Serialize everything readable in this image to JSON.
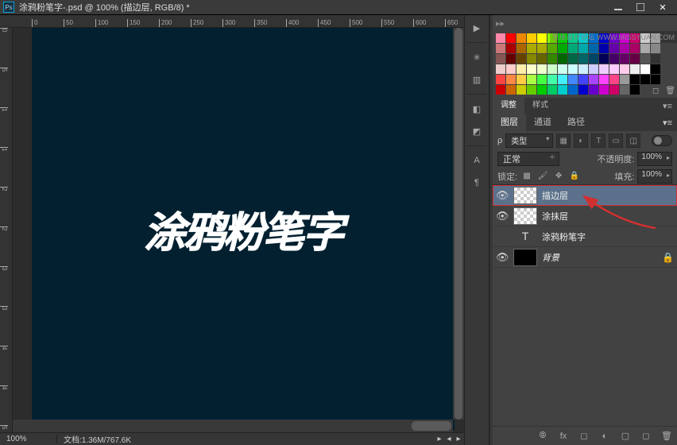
{
  "titlebar": {
    "ps": "Ps",
    "title": "涂鸦粉笔字-.psd @ 100% (描边层, RGB/8) *"
  },
  "ruler_h": [
    "0",
    "50",
    "100",
    "150",
    "200",
    "250",
    "300",
    "350",
    "400",
    "450",
    "500",
    "550",
    "600",
    "650"
  ],
  "ruler_v": [
    "0",
    "5",
    "1",
    "1",
    "2",
    "2",
    "3",
    "3",
    "4",
    "4",
    "5"
  ],
  "canvas_text": "涂鸦粉笔字",
  "status": {
    "zoom": "100%",
    "doc": "文档:1.36M/767.6K"
  },
  "watermark": "思缘设计论坛  WWW.MISSYUAN.COM",
  "adjust_tabs": {
    "t1": "调整",
    "t2": "样式"
  },
  "layers_tabs": {
    "t1": "图层",
    "t2": "通道",
    "t3": "路径"
  },
  "filter": {
    "kind_icon": "ρ",
    "kind": "类型"
  },
  "blend": {
    "mode": "正常",
    "opacity_label": "不透明度:",
    "opacity": "100%"
  },
  "lock": {
    "label": "锁定:",
    "fill_label": "填充:",
    "fill": "100%"
  },
  "layers": [
    {
      "name": "描边层",
      "selected": true,
      "thumb": "checker",
      "eye": true,
      "highlight": true
    },
    {
      "name": "涂抹层",
      "selected": false,
      "thumb": "checker",
      "eye": true,
      "text": false
    },
    {
      "name": "涂鸦粉笔字",
      "selected": false,
      "thumb": "text",
      "eye": false,
      "text": true
    },
    {
      "name": "背景",
      "selected": false,
      "thumb": "dark",
      "eye": true,
      "locked": true,
      "italic": true
    }
  ],
  "swatch_colors": [
    "#f8a",
    "#f00",
    "#e80",
    "#fc0",
    "#ff0",
    "#8f0",
    "#0f0",
    "#0fa",
    "#0ff",
    "#08f",
    "#00f",
    "#80f",
    "#f0f",
    "#f08",
    "#fff",
    "#ccc",
    "#c77",
    "#a00",
    "#a60",
    "#aa0",
    "#aa0",
    "#5a0",
    "#0a0",
    "#0a7",
    "#0aa",
    "#06a",
    "#00a",
    "#60a",
    "#a0a",
    "#a06",
    "#aaa",
    "#888",
    "#855",
    "#600",
    "#640",
    "#880",
    "#660",
    "#380",
    "#060",
    "#064",
    "#066",
    "#046",
    "#005",
    "#406",
    "#606",
    "#604",
    "#555",
    "#333",
    "#ecc",
    "#fcc",
    "#fea",
    "#ffc",
    "#efc",
    "#cfc",
    "#cfe",
    "#cff",
    "#cef",
    "#ccf",
    "#ecf",
    "#fcf",
    "#fce",
    "#eee",
    "#fff",
    "#000",
    "#f44",
    "#f84",
    "#fc4",
    "#af4",
    "#4f4",
    "#4fa",
    "#4ef",
    "#48f",
    "#44f",
    "#a4f",
    "#f4f",
    "#f48",
    "#999",
    "#000",
    "#000",
    "#000",
    "#c00",
    "#c60",
    "#cc0",
    "#6c0",
    "#0c0",
    "#0c6",
    "#0cc",
    "#06c",
    "#00c",
    "#60c",
    "#c0c",
    "#c06",
    "#666",
    "#000",
    "",
    ""
  ]
}
